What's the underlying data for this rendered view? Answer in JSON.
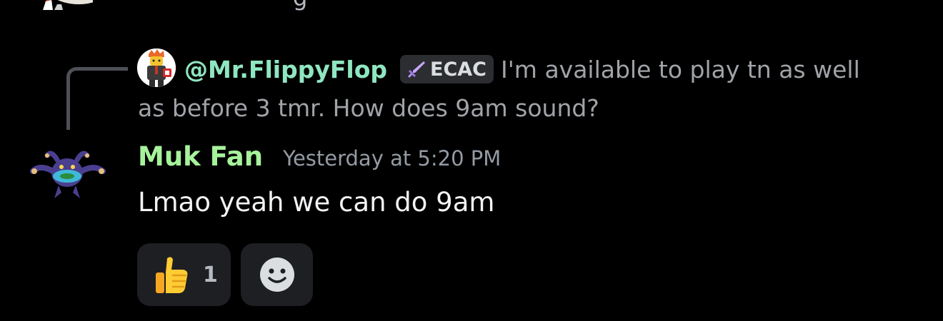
{
  "previous_message": {
    "avatar_icon": "user-avatar-icon",
    "text_fragment": "g"
  },
  "reply": {
    "avatar_icon": "lego-figure-avatar-icon",
    "author": "@Mr.FlippyFlop",
    "clan_tag": {
      "icon": "sword-icon",
      "label": "ECAC"
    },
    "excerpt_line1": "I'm available to play tn as well",
    "excerpt_line2": "as before 3 tmr. How does 9am sound?"
  },
  "message": {
    "avatar_icon": "pokemon-avatar-icon",
    "username": "Muk Fan",
    "timestamp": "Yesterday at 5:20 PM",
    "text": "Lmao yeah we can do 9am"
  },
  "reactions": [
    {
      "emoji": "thumbs-up-icon",
      "count": "1"
    }
  ],
  "add_reaction": {
    "icon": "add-reaction-smiley-icon"
  },
  "colors": {
    "background": "#000000",
    "reply_author": "#8fe6c0",
    "username": "#a6f29b",
    "timestamp": "#949ba4",
    "reaction_bg": "#1e1f22"
  }
}
